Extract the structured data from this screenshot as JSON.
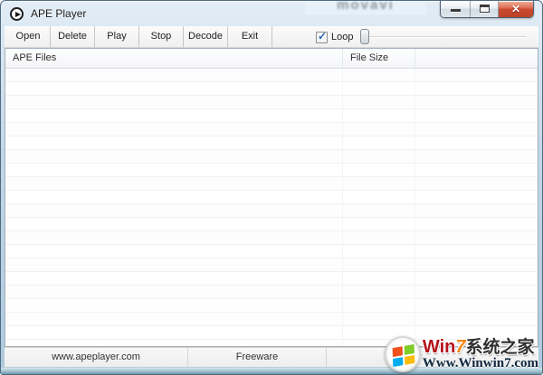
{
  "window": {
    "title": "APE Player"
  },
  "titlebar_watermark": "movavi",
  "icons": {
    "app": "play-circle-icon",
    "check": "✓",
    "close": "✕"
  },
  "toolbar": {
    "buttons": [
      "Open",
      "Delete",
      "Play",
      "Stop",
      "Decode",
      "Exit"
    ],
    "loop": {
      "label": "Loop",
      "checked": true
    },
    "slider": {
      "value": 0,
      "min": 0,
      "max": 100
    }
  },
  "list": {
    "columns": [
      "APE Files",
      "File Size",
      ""
    ],
    "rows": []
  },
  "statusbar": {
    "panels": [
      "www.apeplayer.com",
      "Freeware",
      ""
    ]
  },
  "overlay_watermark": {
    "win": "Win",
    "seven": "7",
    "cn": "系统之家",
    "url": "Www.Winwin7.com"
  },
  "colors": {
    "close_red": "#c94a30",
    "check_blue": "#2c65b0",
    "logo_red": "#f1511b",
    "logo_green": "#80cc28",
    "logo_blue": "#00adef",
    "logo_yellow": "#fbbc09",
    "brand_red": "#b5121b",
    "brand_orange": "#f68712",
    "url_navy": "#0f2740"
  }
}
